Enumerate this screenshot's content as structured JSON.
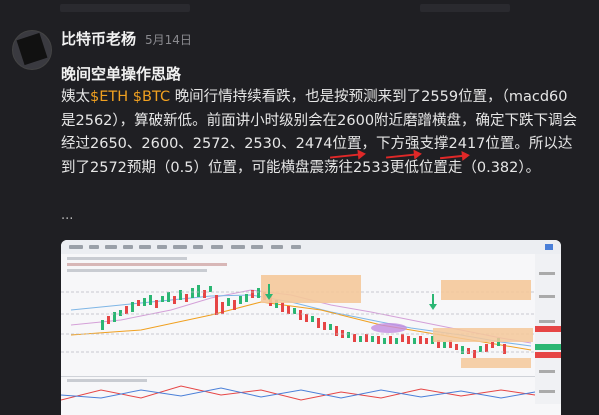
{
  "post": {
    "author": "比特币老杨",
    "date": "5月14日",
    "title": "晚间空单操作思路",
    "body_prefix": "姨太",
    "tag_eth": "$ETH",
    "tag_btc": "$BTC",
    "body_main": "晚间行情持续看跌，也是按预测来到了2559位置，（macd60是2562），算破新低。前面讲小时级别会在2600附近磨蹭横盘，确定下跌下调会经过2650、2600、2572、2530、2474位置，下方强支撑2417位置。所以达到了2572预期（0.5）位置，可能横盘震荡往2533更低位置走（0.382）。",
    "more": "..."
  },
  "chart_image": {
    "description_icon": "chart-screenshot-icon",
    "colors": {
      "up": "#2bb673",
      "down": "#e64545",
      "accent": "#f0a020"
    }
  }
}
